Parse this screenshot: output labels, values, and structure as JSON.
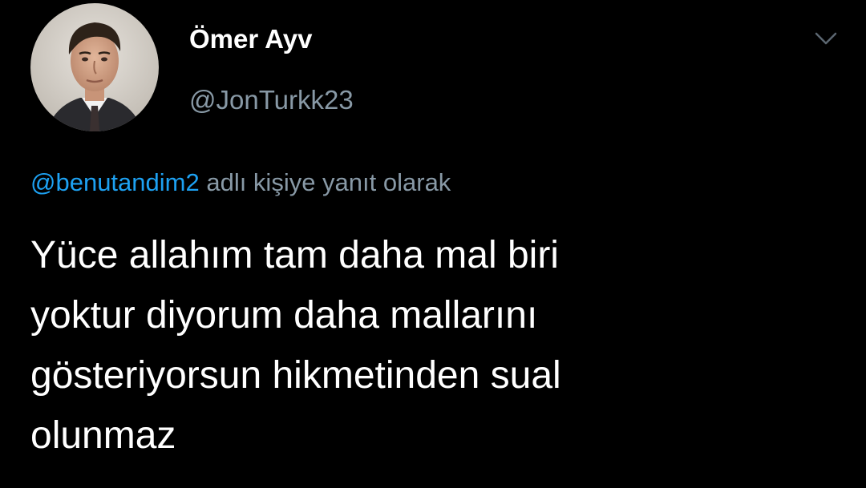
{
  "tweet": {
    "author": {
      "display_name": "Ömer Ayv",
      "handle": "@JonTurkk23",
      "avatar_icon": "profile-photo"
    },
    "reply": {
      "mention": "@benutandim2",
      "suffix": " adlı kişiye yanıt olarak"
    },
    "text_lines": [
      "Yüce allahım tam daha mal biri",
      "yoktur diyorum daha mallarını",
      "gösteriyorsun hikmetinden sual",
      "olunmaz"
    ],
    "more_icon": "chevron-down-icon"
  },
  "colors": {
    "background": "#000000",
    "primary_text": "#ffffff",
    "secondary_text": "#8899a6",
    "accent": "#1da1f2"
  }
}
